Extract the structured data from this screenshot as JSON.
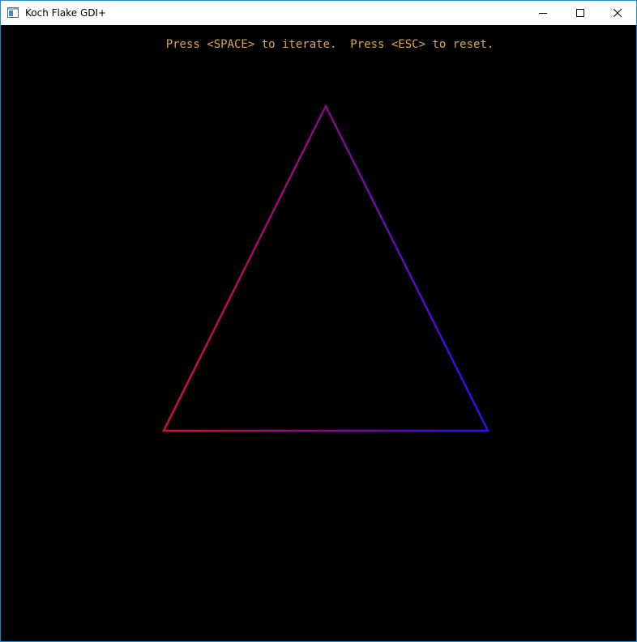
{
  "window": {
    "title": "Koch Flake GDI+",
    "title_icon": "app-window-icon",
    "buttons": {
      "minimize_icon": "minimize-icon",
      "maximize_icon": "maximize-icon",
      "close_icon": "close-icon"
    }
  },
  "canvas": {
    "instructions": "Press <SPACE> to iterate.  Press <ESC> to reset.",
    "instructions_color": "#d9a84a",
    "background_color": "#000000",
    "flake": {
      "iteration": 0,
      "gradient_colors": [
        "#d0103a",
        "#8a0a8a",
        "#2a10f0"
      ]
    }
  }
}
